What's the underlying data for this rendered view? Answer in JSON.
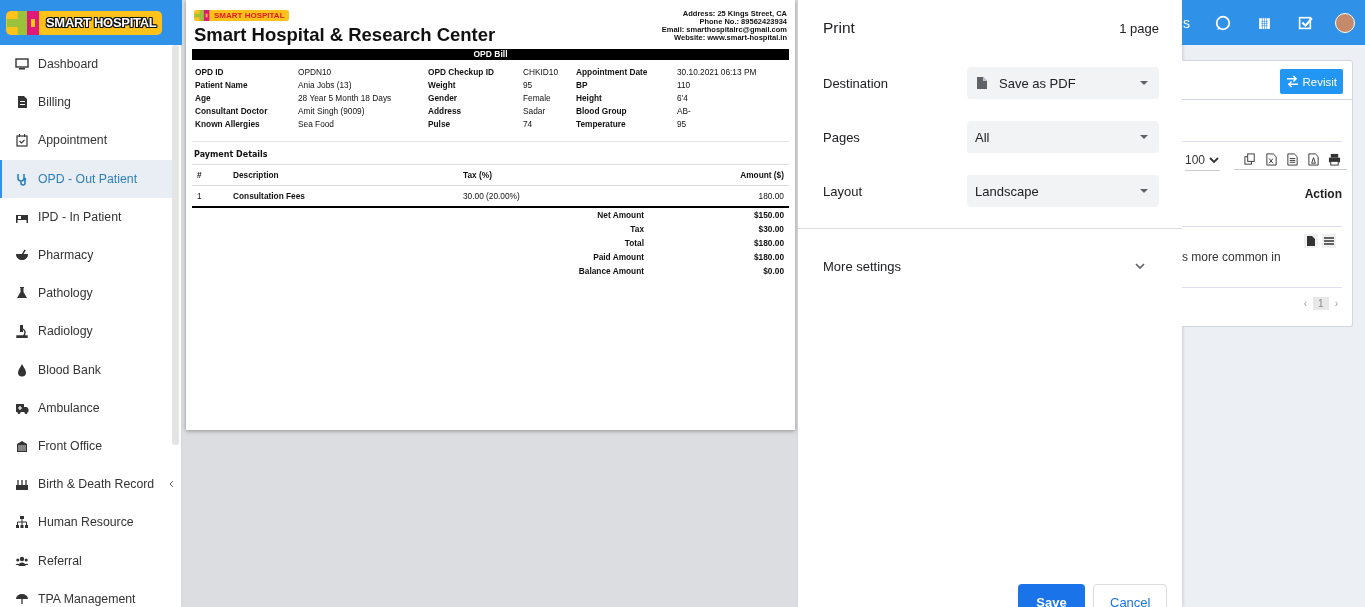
{
  "app": {
    "logo": "SMART HOSPITAL"
  },
  "sidebar": {
    "items": [
      {
        "label": "Dashboard",
        "selected": false,
        "kind": "link"
      },
      {
        "label": "Billing",
        "selected": false,
        "kind": "link"
      },
      {
        "label": "Appointment",
        "selected": false,
        "kind": "link"
      },
      {
        "label": "OPD - Out Patient",
        "selected": true,
        "kind": "link"
      },
      {
        "label": "IPD - In Patient",
        "selected": false,
        "kind": "link"
      },
      {
        "label": "Pharmacy",
        "selected": false,
        "kind": "link"
      },
      {
        "label": "Pathology",
        "selected": false,
        "kind": "link"
      },
      {
        "label": "Radiology",
        "selected": false,
        "kind": "link"
      },
      {
        "label": "Blood Bank",
        "selected": false,
        "kind": "link"
      },
      {
        "label": "Ambulance",
        "selected": false,
        "kind": "link"
      },
      {
        "label": "Front Office",
        "selected": false,
        "kind": "link"
      },
      {
        "label": "Birth & Death Record",
        "selected": false,
        "kind": "menu"
      },
      {
        "label": "Human Resource",
        "selected": false,
        "kind": "link"
      },
      {
        "label": "Referral",
        "selected": false,
        "kind": "link"
      },
      {
        "label": "TPA Management",
        "selected": false,
        "kind": "link"
      }
    ]
  },
  "print_preview": {
    "bill": {
      "logo": "SMART HOSPITAL",
      "title": "Smart Hospital & Research Center",
      "address_lines": [
        "Address: 25 Kings Street, CA",
        "Phone No.: 89562423934",
        "Email: smarthospitalrc@gmail.com",
        "Website: www.smart-hospital.in"
      ],
      "heading": "OPD Bill",
      "fields": [
        {
          "label": "OPD ID",
          "value": "OPDN10"
        },
        {
          "label": "OPD Checkup ID",
          "value": "CHKID10"
        },
        {
          "label": "Appointment Date",
          "value": "30.10.2021 06:13 PM"
        },
        {
          "label": "Patient Name",
          "value": "Ania Jobs (13)"
        },
        {
          "label": "Weight",
          "value": "95"
        },
        {
          "label": "BP",
          "value": "110"
        },
        {
          "label": "Age",
          "value": "28 Year 5 Month 18 Days"
        },
        {
          "label": "Gender",
          "value": "Female"
        },
        {
          "label": "Height",
          "value": "6'4"
        },
        {
          "label": "Consultant Doctor",
          "value": "Amit Singh (9009)"
        },
        {
          "label": "Address",
          "value": "Sadar"
        },
        {
          "label": "Blood Group",
          "value": "AB-"
        },
        {
          "label": "Known Allergies",
          "value": "Sea Food"
        },
        {
          "label": "Pulse",
          "value": "74"
        },
        {
          "label": "Temperature",
          "value": "95"
        }
      ],
      "payment": {
        "title": "Payment Details",
        "columns": [
          "#",
          "Description",
          "Tax (%)",
          "Amount ($)"
        ],
        "rows": [
          [
            "1",
            "Consultation Fees",
            "30.00 (20.00%)",
            "180.00"
          ]
        ],
        "totals": [
          {
            "label": "Net Amount",
            "value": "$150.00"
          },
          {
            "label": "Tax",
            "value": "$30.00"
          },
          {
            "label": "Total",
            "value": "$180.00"
          },
          {
            "label": "Paid Amount",
            "value": "$180.00"
          },
          {
            "label": "Balance Amount",
            "value": "$0.00"
          }
        ]
      }
    }
  },
  "print_settings": {
    "title": "Print",
    "page_count": "1 page",
    "settings": [
      {
        "label": "Destination",
        "value": "Save as PDF",
        "kind": "destination"
      },
      {
        "label": "Pages",
        "value": "All",
        "kind": "select"
      },
      {
        "label": "Layout",
        "value": "Landscape",
        "kind": "select"
      }
    ],
    "more_settings": {
      "label": "More settings",
      "expanded": false
    },
    "buttons": [
      {
        "label": "Save",
        "kind": "primary"
      },
      {
        "label": "Cancel",
        "kind": "secondary"
      }
    ]
  },
  "header": {
    "text": "s"
  },
  "card": {
    "revisit": "Revisit",
    "page_size": "100",
    "column_header": "Action",
    "row_text": "s more common in",
    "pagination": {
      "prev": "‹",
      "pages": [
        {
          "label": "1",
          "selected": true
        }
      ],
      "next": "›"
    }
  }
}
